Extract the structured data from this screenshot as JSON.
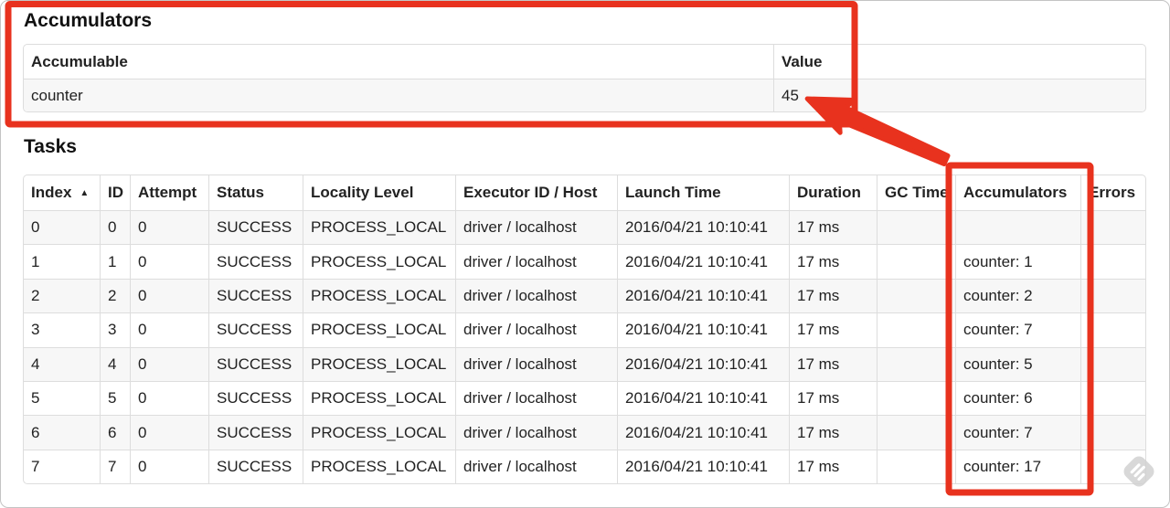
{
  "accumulators_section": {
    "title": "Accumulators",
    "columns": [
      "Accumulable",
      "Value"
    ],
    "rows": [
      {
        "accumulable": "counter",
        "value": "45"
      }
    ]
  },
  "tasks_section": {
    "title": "Tasks",
    "columns": [
      "Index",
      "ID",
      "Attempt",
      "Status",
      "Locality Level",
      "Executor ID / Host",
      "Launch Time",
      "Duration",
      "GC Time",
      "Accumulators",
      "Errors"
    ],
    "sort": {
      "column": "Index",
      "direction": "ascending",
      "glyph": "▲"
    },
    "rows": [
      {
        "index": "0",
        "id": "0",
        "attempt": "0",
        "status": "SUCCESS",
        "locality_level": "PROCESS_LOCAL",
        "executor_id_host": "driver / localhost",
        "launch_time": "2016/04/21 10:10:41",
        "duration": "17 ms",
        "gc_time": "",
        "accumulators": "",
        "errors": ""
      },
      {
        "index": "1",
        "id": "1",
        "attempt": "0",
        "status": "SUCCESS",
        "locality_level": "PROCESS_LOCAL",
        "executor_id_host": "driver / localhost",
        "launch_time": "2016/04/21 10:10:41",
        "duration": "17 ms",
        "gc_time": "",
        "accumulators": "counter: 1",
        "errors": ""
      },
      {
        "index": "2",
        "id": "2",
        "attempt": "0",
        "status": "SUCCESS",
        "locality_level": "PROCESS_LOCAL",
        "executor_id_host": "driver / localhost",
        "launch_time": "2016/04/21 10:10:41",
        "duration": "17 ms",
        "gc_time": "",
        "accumulators": "counter: 2",
        "errors": ""
      },
      {
        "index": "3",
        "id": "3",
        "attempt": "0",
        "status": "SUCCESS",
        "locality_level": "PROCESS_LOCAL",
        "executor_id_host": "driver / localhost",
        "launch_time": "2016/04/21 10:10:41",
        "duration": "17 ms",
        "gc_time": "",
        "accumulators": "counter: 7",
        "errors": ""
      },
      {
        "index": "4",
        "id": "4",
        "attempt": "0",
        "status": "SUCCESS",
        "locality_level": "PROCESS_LOCAL",
        "executor_id_host": "driver / localhost",
        "launch_time": "2016/04/21 10:10:41",
        "duration": "17 ms",
        "gc_time": "",
        "accumulators": "counter: 5",
        "errors": ""
      },
      {
        "index": "5",
        "id": "5",
        "attempt": "0",
        "status": "SUCCESS",
        "locality_level": "PROCESS_LOCAL",
        "executor_id_host": "driver / localhost",
        "launch_time": "2016/04/21 10:10:41",
        "duration": "17 ms",
        "gc_time": "",
        "accumulators": "counter: 6",
        "errors": ""
      },
      {
        "index": "6",
        "id": "6",
        "attempt": "0",
        "status": "SUCCESS",
        "locality_level": "PROCESS_LOCAL",
        "executor_id_host": "driver / localhost",
        "launch_time": "2016/04/21 10:10:41",
        "duration": "17 ms",
        "gc_time": "",
        "accumulators": "counter: 7",
        "errors": ""
      },
      {
        "index": "7",
        "id": "7",
        "attempt": "0",
        "status": "SUCCESS",
        "locality_level": "PROCESS_LOCAL",
        "executor_id_host": "driver / localhost",
        "launch_time": "2016/04/21 10:10:41",
        "duration": "17 ms",
        "gc_time": "",
        "accumulators": "counter: 17",
        "errors": ""
      }
    ]
  },
  "annotations": {
    "color": "#e8321e",
    "highlighted_value": "45",
    "highlighted_column": "Accumulators"
  },
  "watermark": {
    "color": "#d2d2d2",
    "stripe_color": "#ffffff"
  }
}
